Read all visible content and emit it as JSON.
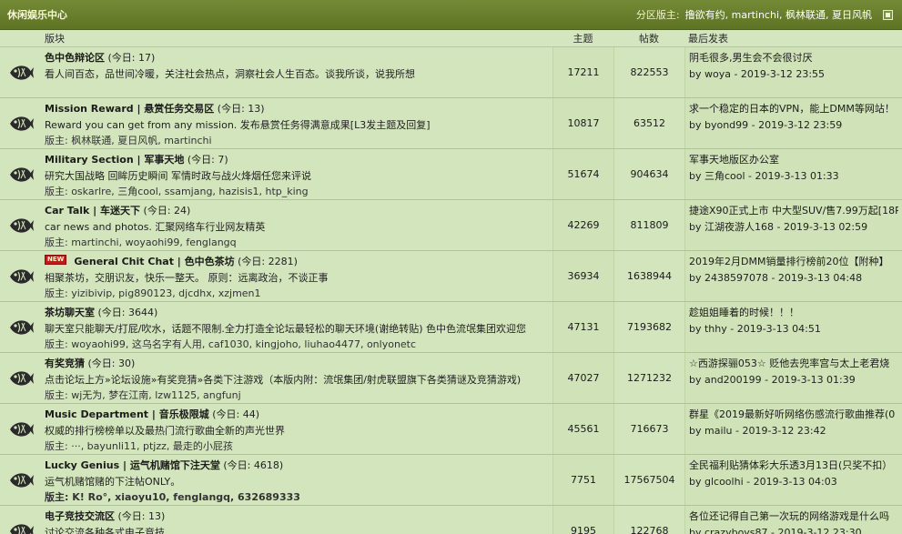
{
  "category": {
    "title": "休闲娱乐中心",
    "moderators_label": "分区版主:",
    "moderators": "撸欲有约, martinchi, 枫林联通, 夏日风帆"
  },
  "columns": {
    "board": "版块",
    "topics": "主题",
    "posts": "帖数",
    "last_post": "最后发表"
  },
  "boards": [
    {
      "name": "色中色辩论区",
      "today": "(今日: 17)",
      "desc": "看人间百态，品世间冷暖，关注社会热点，洞察社会人生百态。谈我所谈，说我所想",
      "mods": "",
      "topics": "17211",
      "posts": "822553",
      "last_title": "阴毛很多,男生会不会很讨厌",
      "last_meta": "by woya - 2019-3-12 23:55"
    },
    {
      "name": "Mission Reward | 悬赏任务交易区",
      "today": "(今日: 13)",
      "desc": "Reward you can get from any mission. 发布悬赏任务得满意成果[L3发主题及回复]",
      "mods": "版主: 枫林联通, 夏日风帆, martinchi",
      "topics": "10817",
      "posts": "63512",
      "last_title": "求一个稳定的日本的VPN，能上DMM等网站！",
      "last_meta": "by byond99 - 2019-3-12 23:59"
    },
    {
      "name": "Military Section | 军事天地",
      "today": "(今日: 7)",
      "desc": "研究大国战略 回眸历史瞬间 军情时政与战火烽烟任您来评说",
      "mods": "版主: oskarlre, 三角cool, ssamjang, hazisis1, htp_king",
      "topics": "51674",
      "posts": "904634",
      "last_title": "军事天地版区办公室",
      "last_meta": "by 三角cool - 2019-3-13 01:33"
    },
    {
      "name": "Car Talk | 车迷天下",
      "today": "(今日: 24)",
      "desc": "car news and photos. 汇聚网络车行业网友精英",
      "mods": "版主: martinchi, woyaohi99, fenglangq",
      "topics": "42269",
      "posts": "811809",
      "last_title": "捷途X90正式上市 中大型SUV/售7.99万起[18P",
      "last_meta": "by 江湖夜游人168 - 2019-3-13 02:59"
    },
    {
      "name": "General Chit Chat | 色中色茶坊",
      "today": "(今日: 2281)",
      "badge": "NEW",
      "desc": "相聚茶坊，交朋识友，快乐一整天。 原则：远离政治，不谈正事",
      "mods": "版主: yizibivip, pig890123, djcdhx, xzjmen1",
      "topics": "36934",
      "posts": "1638944",
      "last_title": "2019年2月DMM销量排行榜前20位【附种】",
      "last_meta": "by 2438597078 - 2019-3-13 04:48"
    },
    {
      "name": "茶坊聊天室",
      "today": "(今日: 3644)",
      "desc": "聊天室只能聊天/打屁/吹水，话题不限制.全力打造全论坛最轻松的聊天环境(谢绝转贴) 色中色流氓集团欢迎您",
      "mods": "版主: woyaohi99, 这乌名字有人用, caf1030, kingjoho, liuhao4477, onlyonetc",
      "topics": "47131",
      "posts": "7193682",
      "last_title": "趁姐姐睡着的时候！！！",
      "last_meta": "by thhy - 2019-3-13 04:51"
    },
    {
      "name": "有奖竞猜",
      "today": "(今日: 30)",
      "desc": "点击论坛上方»论坛设施»有奖竞猜»各类下注游戏（本版内附：流氓集团/射虎联盟旗下各类猜谜及竞猜游戏)",
      "mods": "版主: wj无为, 梦在江南, lzw1125, angfunj",
      "topics": "47027",
      "posts": "1271232",
      "last_title": "☆西游探骊053☆ 贬他去兜率宫与太上老君烧",
      "last_meta": "by and200199 - 2019-3-13 01:39"
    },
    {
      "name": "Music Department | 音乐极限城",
      "today": "(今日: 44)",
      "desc": "权威的排行榜榜单以及最热门流行歌曲全新的声光世界",
      "mods": "版主: ···, bayunli11, ptjzz, 最走的小屁孩",
      "topics": "45561",
      "posts": "716673",
      "last_title": "群星《2019最新好听网络伤感流行歌曲推荐(0",
      "last_meta": "by mailu - 2019-3-12 23:42"
    },
    {
      "name": "Lucky Genius | 运气机赌馆下注天堂",
      "today": "(今日: 4618)",
      "desc": "运气机赌馆赌的下注帖ONLY。",
      "mods": "版主: K! Ro°, xiaoyu10, fenglangq, 632689333",
      "mods_bold": true,
      "topics": "7751",
      "posts": "17567504",
      "last_title": "全民福利贴猜体彩大乐透3月13日(只奖不扣）",
      "last_meta": "by glcoolhi - 2019-3-13 04:03"
    },
    {
      "name": "电子竞技交流区",
      "today": "(今日: 13)",
      "desc": "讨论交流各种各式电子竞技",
      "mods": "版主: vincent_utopia, tony3088, ssamjang, wj无为",
      "topics": "9195",
      "posts": "122768",
      "last_title": "各位还记得自己第一次玩的网络游戏是什么吗",
      "last_meta": "by crazyboys87 - 2019-3-12 23:30"
    }
  ]
}
